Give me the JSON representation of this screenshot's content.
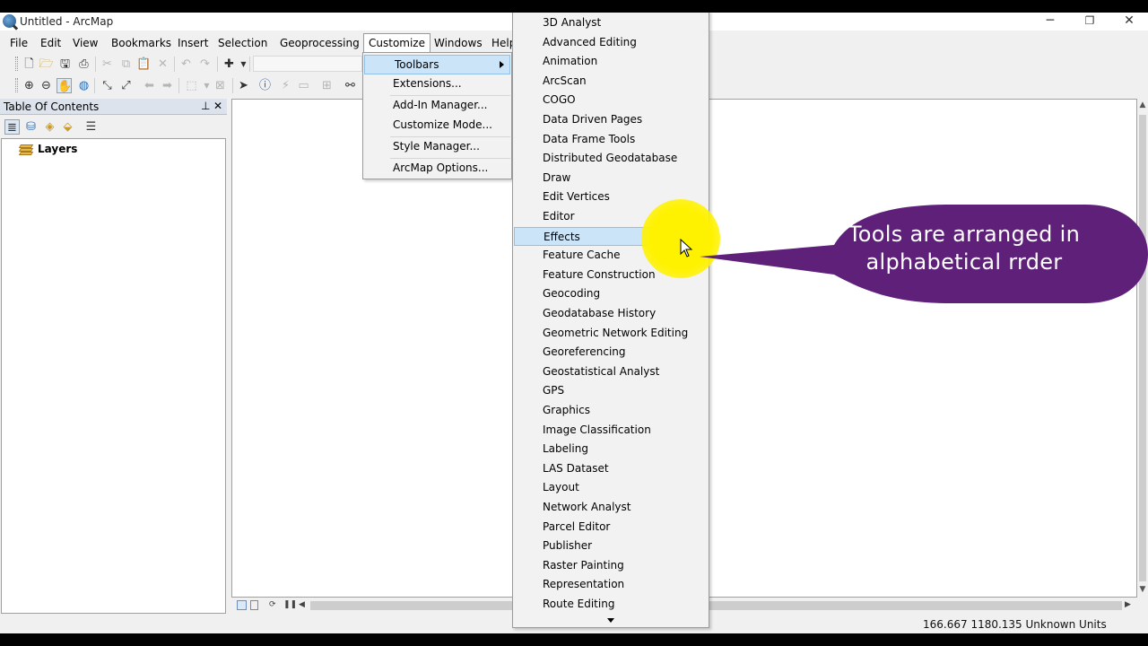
{
  "window": {
    "title": "Untitled - ArcMap",
    "minimize_glyph": "─",
    "restore_glyph": "❐",
    "close_glyph": "✕"
  },
  "menubar": {
    "items": [
      "File",
      "Edit",
      "View",
      "Bookmarks",
      "Insert",
      "Selection",
      "Geoprocessing",
      "Customize",
      "Windows",
      "Help"
    ]
  },
  "customize_menu": {
    "items": [
      {
        "label": "Toolbars",
        "highlighted": true,
        "has_submenu": true
      },
      {
        "label": "Extensions..."
      },
      {
        "label": "Add-In Manager..."
      },
      {
        "label": "Customize Mode..."
      },
      {
        "label": "Style Manager..."
      },
      {
        "label": "ArcMap Options..."
      }
    ]
  },
  "toolbars_submenu": {
    "highlighted": "Effects",
    "items": [
      "3D Analyst",
      "Advanced Editing",
      "Animation",
      "ArcScan",
      "COGO",
      "Data Driven Pages",
      "Data Frame Tools",
      "Distributed Geodatabase",
      "Draw",
      "Edit Vertices",
      "Editor",
      "Effects",
      "Feature Cache",
      "Feature Construction",
      "Geocoding",
      "Geodatabase History",
      "Geometric Network Editing",
      "Georeferencing",
      "Geostatistical Analyst",
      "GPS",
      "Graphics",
      "Image Classification",
      "Labeling",
      "LAS Dataset",
      "Layout",
      "Network Analyst",
      "Parcel Editor",
      "Publisher",
      "Raster Painting",
      "Representation",
      "Route Editing"
    ]
  },
  "toc": {
    "title": "Table Of Contents",
    "pin_glyph": "⊥",
    "close_glyph": "✕",
    "root_layer": "Layers"
  },
  "statusbar": {
    "coordinates": "166.667  1180.135 Unknown Units"
  },
  "callout": {
    "line1": "Tools are arranged in",
    "line2": "alphabetical rrder",
    "color": "#5e2079",
    "text_color": "#ffffff"
  },
  "colors": {
    "menu_highlight": "#cce4f7",
    "toc_header": "#dce3ed",
    "cursor_glow": "#fff200"
  }
}
